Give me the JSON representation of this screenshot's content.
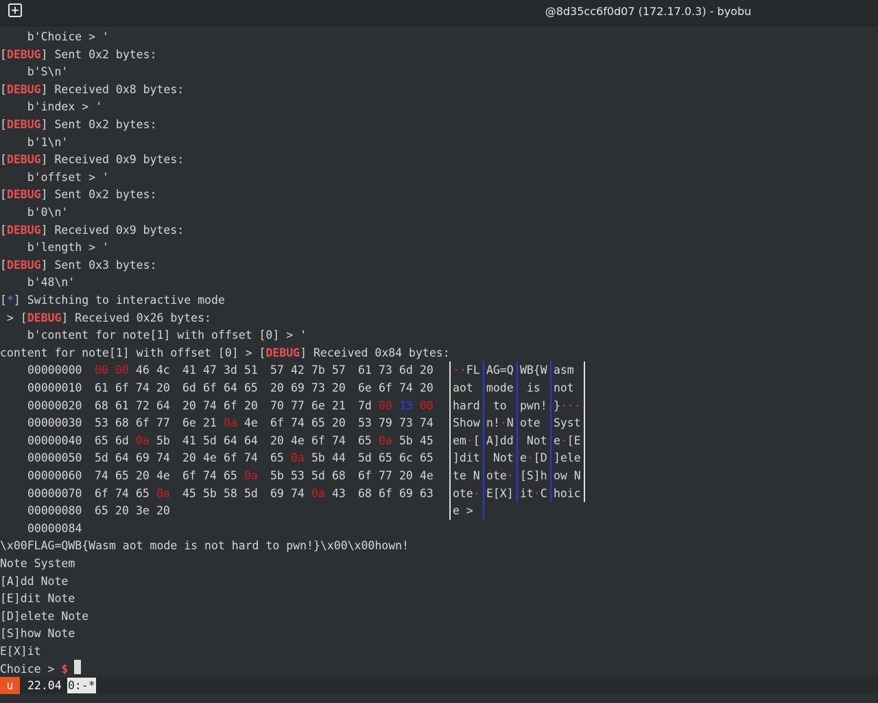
{
  "window": {
    "title": "@8d35cc6f0d07 (172.17.0.3) - byobu",
    "new_tab_icon": "plus-square-icon"
  },
  "log": [
    {
      "p": "    ",
      "m": "",
      "t": "b'Choice > '"
    },
    {
      "p": "",
      "m": "DEBUG",
      "t": " Sent 0x2 bytes:"
    },
    {
      "p": "    ",
      "m": "",
      "t": "b'S\\n'"
    },
    {
      "p": "",
      "m": "DEBUG",
      "t": " Received 0x8 bytes:"
    },
    {
      "p": "    ",
      "m": "",
      "t": "b'index > '"
    },
    {
      "p": "",
      "m": "DEBUG",
      "t": " Sent 0x2 bytes:"
    },
    {
      "p": "    ",
      "m": "",
      "t": "b'1\\n'"
    },
    {
      "p": "",
      "m": "DEBUG",
      "t": " Received 0x9 bytes:"
    },
    {
      "p": "    ",
      "m": "",
      "t": "b'offset > '"
    },
    {
      "p": "",
      "m": "DEBUG",
      "t": " Sent 0x2 bytes:"
    },
    {
      "p": "    ",
      "m": "",
      "t": "b'0\\n'"
    },
    {
      "p": "",
      "m": "DEBUG",
      "t": " Received 0x9 bytes:"
    },
    {
      "p": "    ",
      "m": "",
      "t": "b'length > '"
    },
    {
      "p": "",
      "m": "DEBUG",
      "t": " Sent 0x3 bytes:"
    },
    {
      "p": "    ",
      "m": "",
      "t": "b'48\\n'"
    },
    {
      "p": "",
      "m": "*",
      "t": " Switching to interactive mode"
    },
    {
      "p": " > ",
      "m": "DEBUG",
      "t": " Received 0x26 bytes:"
    },
    {
      "p": "    ",
      "m": "",
      "t": "b'content for note[1] with offset [0] > '"
    },
    {
      "p": "content for note[1] with offset [0] > ",
      "m": "DEBUG",
      "t": " Received 0x84 bytes:"
    }
  ],
  "hexdump": [
    {
      "off": "00000000",
      "b": [
        "00",
        "00",
        "46",
        "4c",
        "41",
        "47",
        "3d",
        "51",
        "57",
        "42",
        "7b",
        "57",
        "61",
        "73",
        "6d",
        "20"
      ],
      "a": "··FLAG=QWB{Wasm "
    },
    {
      "off": "00000010",
      "b": [
        "61",
        "6f",
        "74",
        "20",
        "6d",
        "6f",
        "64",
        "65",
        "20",
        "69",
        "73",
        "20",
        "6e",
        "6f",
        "74",
        "20"
      ],
      "a": "aot mode is not "
    },
    {
      "off": "00000020",
      "b": [
        "68",
        "61",
        "72",
        "64",
        "20",
        "74",
        "6f",
        "20",
        "70",
        "77",
        "6e",
        "21",
        "7d",
        "00",
        "13",
        "00"
      ],
      "a": "hard to pwn!}···"
    },
    {
      "off": "00000030",
      "b": [
        "53",
        "68",
        "6f",
        "77",
        "6e",
        "21",
        "0a",
        "4e",
        "6f",
        "74",
        "65",
        "20",
        "53",
        "79",
        "73",
        "74"
      ],
      "a": "Shown!·Note Syst"
    },
    {
      "off": "00000040",
      "b": [
        "65",
        "6d",
        "0a",
        "5b",
        "41",
        "5d",
        "64",
        "64",
        "20",
        "4e",
        "6f",
        "74",
        "65",
        "0a",
        "5b",
        "45"
      ],
      "a": "em·[A]dd Note·[E"
    },
    {
      "off": "00000050",
      "b": [
        "5d",
        "64",
        "69",
        "74",
        "20",
        "4e",
        "6f",
        "74",
        "65",
        "0a",
        "5b",
        "44",
        "5d",
        "65",
        "6c",
        "65"
      ],
      "a": "]dit Note·[D]ele"
    },
    {
      "off": "00000060",
      "b": [
        "74",
        "65",
        "20",
        "4e",
        "6f",
        "74",
        "65",
        "0a",
        "5b",
        "53",
        "5d",
        "68",
        "6f",
        "77",
        "20",
        "4e"
      ],
      "a": "te Note·[S]how N"
    },
    {
      "off": "00000070",
      "b": [
        "6f",
        "74",
        "65",
        "0a",
        "45",
        "5b",
        "58",
        "5d",
        "69",
        "74",
        "0a",
        "43",
        "68",
        "6f",
        "69",
        "63"
      ],
      "a": "ote·E[X]it·Choic"
    },
    {
      "off": "00000080",
      "b": [
        "65",
        "20",
        "3e",
        "20"
      ],
      "a": "e > "
    },
    {
      "off": "00000084",
      "b": [],
      "a": ""
    }
  ],
  "output": [
    "\\x00FLAG=QWB{Wasm aot mode is not hard to pwn!}\\x00\\x00hown!",
    "Note System",
    "[A]dd Note",
    "[E]dit Note",
    "[D]elete Note",
    "[S]how Note",
    "E[X]it"
  ],
  "prompt": {
    "text": "Choice > ",
    "symbol": "$"
  },
  "statusbar": {
    "session": "u",
    "version": "22.04",
    "window": "0:-*"
  },
  "colors": {
    "debug": "#ef4f4f",
    "star": "#6d7dff",
    "null_byte": "#cc1f1f",
    "ctrl_byte": "#2b3cff",
    "status_accent": "#e95420"
  }
}
